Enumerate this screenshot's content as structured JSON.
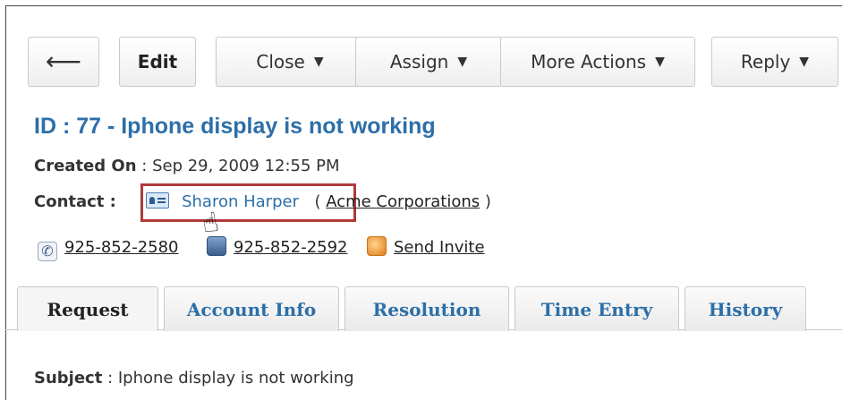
{
  "toolbar": {
    "back_icon": "arrow-left-icon",
    "edit_label": "Edit",
    "close_label": "Close",
    "assign_label": "Assign",
    "more_actions_label": "More Actions",
    "reply_label": "Reply",
    "caret": "▼"
  },
  "request": {
    "title": "ID : 77 - Iphone display is not working",
    "created_on_label": "Created On",
    "created_on_value": "Sep 29, 2009 12:55 PM",
    "contact_label": "Contact :",
    "contact_name": "Sharon Harper",
    "company": "Acme Corporations",
    "phone": "925-852-2580",
    "mobile": "925-852-2592",
    "send_invite": "Send Invite"
  },
  "tabs": [
    {
      "label": "Request",
      "active": true
    },
    {
      "label": "Account Info"
    },
    {
      "label": "Resolution"
    },
    {
      "label": "Time Entry"
    },
    {
      "label": "History"
    }
  ],
  "subject": {
    "label": "Subject",
    "value": "Iphone display is not working"
  },
  "colors": {
    "title_blue": "#2d6fa8",
    "highlight_red": "#b03a3a"
  }
}
